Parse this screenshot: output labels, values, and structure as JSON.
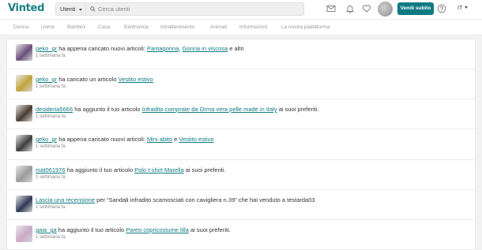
{
  "header": {
    "logo": "Vinted",
    "search_category": "Utenti",
    "search_placeholder": "Cerca utenti",
    "sell_button": "Vendi subito",
    "language": "IT",
    "icons": [
      "mail-icon",
      "bell-icon",
      "heart-icon",
      "avatar",
      "help-icon"
    ]
  },
  "categories": [
    "Donna",
    "Uomo",
    "Bambini",
    "Casa",
    "Elettronica",
    "Intrattenimento",
    "Animali",
    "Informazioni",
    "La nostra piattaforma"
  ],
  "notifications": [
    {
      "user": "geko_gr",
      "text1": " ha appena caricato nuovi articoli: ",
      "link1": "Pantagonna",
      "text2": ", ",
      "link2": "Gonna in viscosa",
      "text3": " e altri",
      "time": "1 settimana fa",
      "thumb_color": "#6b4f7a"
    },
    {
      "user": "geko_gr",
      "text1": " ha caricato un articolo ",
      "link1": "Vestito estivo",
      "time": "1 settimana fa",
      "thumb_color": "#c2a33a"
    },
    {
      "user": "desideria5666",
      "text1": " ha aggiunto il tuo articolo ",
      "link1": "Infradito comprate da Orma vera pelle made in Italy",
      "text2": " ai suoi preferiti.",
      "time": "1 settimana fa",
      "thumb_color": "#4a3b30"
    },
    {
      "user": "geko_gr",
      "text1": " ha appena caricato nuovi articoli: ",
      "link1": "Mini abito",
      "text2": " e ",
      "link2": "Vestito estivo",
      "time": "1 settimana fa",
      "thumb_color": "#3d3d3d"
    },
    {
      "user": "mat061976",
      "text1": " ha aggiunto il tuo articolo ",
      "link1": "Polo t-shirt Marella",
      "text2": " ai suoi preferiti.",
      "time": "1 settimana fa",
      "thumb_color": "#9a9a9a"
    },
    {
      "link0": "Lascia una recensione",
      "text1": " per “Sandali infradito scamosciati con cavigliera n.39” che hai venduto a testarda03",
      "time": "1 settimana fa",
      "thumb_color": "#2f3a56"
    },
    {
      "user": "gaia_ga",
      "text1": " ha aggiunto il tuo articolo ",
      "link1": "Pareo copricostume lilla",
      "text2": " ai suoi preferiti.",
      "time": "1 settimana fa",
      "thumb_color": "#c9a9c7"
    }
  ]
}
